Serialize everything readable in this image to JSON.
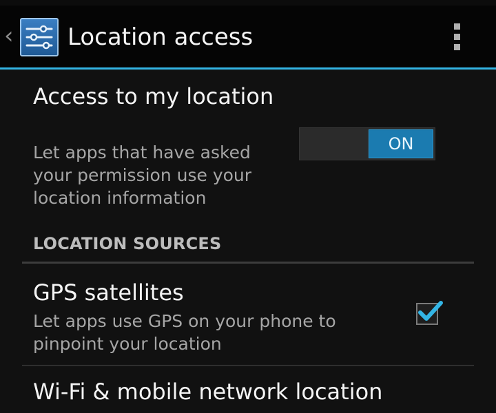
{
  "action_bar": {
    "title": "Location access",
    "up_icon": "chevron-left-icon",
    "app_icon": "settings-sliders-icon",
    "menu_icon": "overflow-menu-icon",
    "accent_color": "#33b5e5"
  },
  "master_switch": {
    "title": "Access to my location",
    "summary": "Let apps that have asked your permission use your location information",
    "state_label": "ON",
    "on_color": "#1b7bb0"
  },
  "location_sources": {
    "header": "LOCATION SOURCES",
    "items": [
      {
        "title": "GPS satellites",
        "summary": "Let apps use GPS on your phone to pinpoint your location",
        "checked": true
      },
      {
        "title": "Wi-Fi & mobile network location"
      }
    ]
  }
}
